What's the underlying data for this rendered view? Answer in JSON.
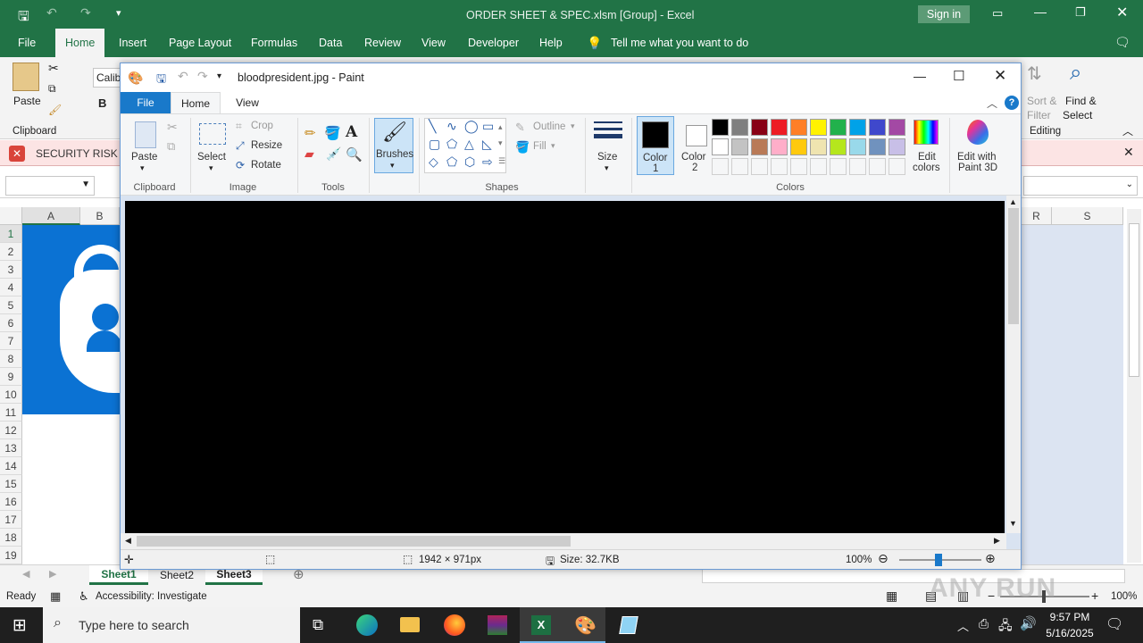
{
  "excel": {
    "title": "ORDER SHEET & SPEC.xlsm  [Group]  -  Excel",
    "sign_in": "Sign in",
    "menu_tabs": [
      "File",
      "Home",
      "Insert",
      "Page Layout",
      "Formulas",
      "Data",
      "Review",
      "View",
      "Developer",
      "Help"
    ],
    "tell_me": "Tell me what you want to do",
    "font_name": "Calib",
    "paste": "Paste",
    "clipboard": "Clipboard",
    "bold": "B",
    "sort_filter_1": "Sort &",
    "sort_filter_2": "Filter",
    "find_select_1": "Find &",
    "find_select_2": "Select",
    "editing": "Editing",
    "security_label": "SECURITY RISK",
    "col_a": "A",
    "col_b": "B",
    "col_r": "R",
    "col_s": "S",
    "rows": [
      "1",
      "2",
      "3",
      "4",
      "5",
      "6",
      "7",
      "8",
      "9",
      "10",
      "11",
      "12",
      "13",
      "14",
      "15",
      "16",
      "17",
      "18",
      "19"
    ],
    "sheets": [
      "Sheet1",
      "Sheet2",
      "Sheet3"
    ],
    "status_ready": "Ready",
    "accessibility": "Accessibility: Investigate",
    "zoom": "100%"
  },
  "paint": {
    "title": "bloodpresident.jpg - Paint",
    "tab_file": "File",
    "tab_home": "Home",
    "tab_view": "View",
    "paste": "Paste",
    "clipboard_group": "Clipboard",
    "select": "Select",
    "crop": "Crop",
    "resize": "Resize",
    "rotate": "Rotate",
    "image_group": "Image",
    "tools_group": "Tools",
    "brushes": "Brushes",
    "outline": "Outline",
    "fill": "Fill",
    "shapes_group": "Shapes",
    "size": "Size",
    "color1_a": "Color",
    "color1_b": "1",
    "color2_a": "Color",
    "color2_b": "2",
    "edit_colors_a": "Edit",
    "edit_colors_b": "colors",
    "colors_group": "Colors",
    "paint3d_a": "Edit with",
    "paint3d_b": "Paint 3D",
    "dimensions": "1942 × 971px",
    "filesize": "Size: 32.7KB",
    "zoom": "100%",
    "palette_row1": [
      "#000000",
      "#7f7f7f",
      "#880015",
      "#ed1c24",
      "#ff7f27",
      "#fff200",
      "#22b14c",
      "#00a2e8",
      "#3f48cc",
      "#a349a4"
    ],
    "palette_row2": [
      "#ffffff",
      "#c3c3c3",
      "#b97a57",
      "#ffaec9",
      "#ffc90e",
      "#efe4b0",
      "#b5e61d",
      "#99d9ea",
      "#7092be",
      "#c8bfe7"
    ]
  },
  "taskbar": {
    "search_placeholder": "Type here to search",
    "time": "9:57 PM",
    "date": "5/16/2025"
  },
  "watermark": "ANY RUN"
}
